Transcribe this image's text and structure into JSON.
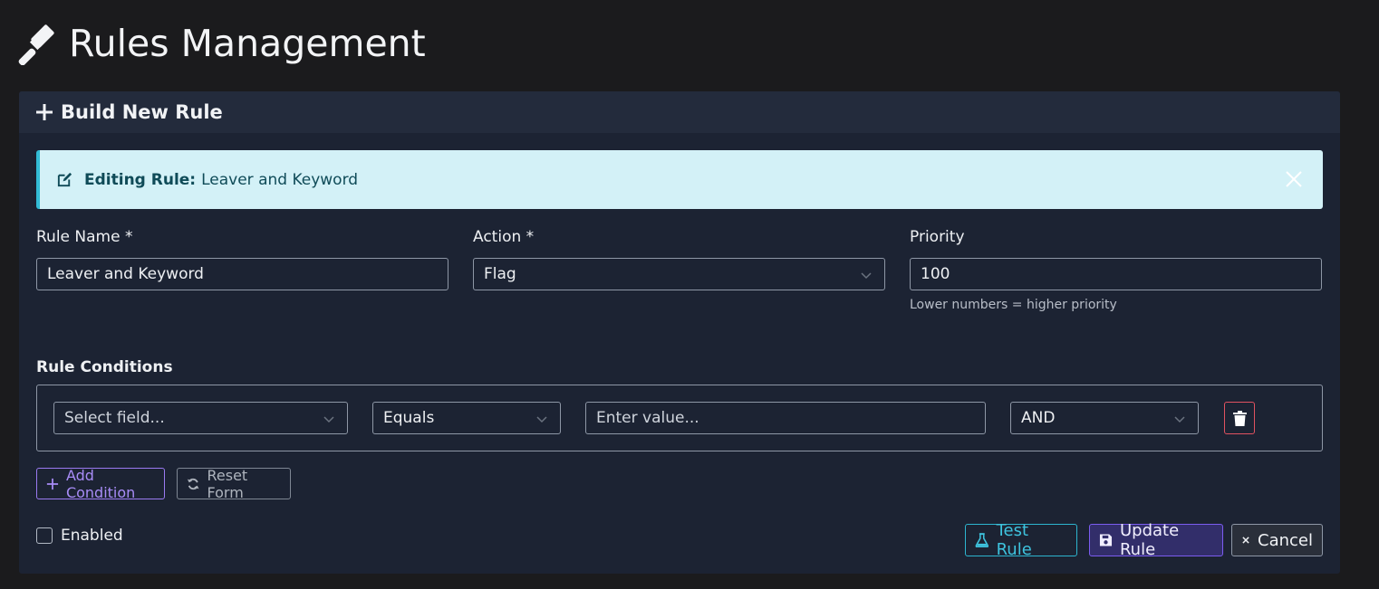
{
  "page": {
    "title": "Rules Management"
  },
  "card": {
    "header": "Build New Rule"
  },
  "alert": {
    "label": "Editing Rule:",
    "rule_name": "Leaver and Keyword"
  },
  "form": {
    "rule_name": {
      "label": "Rule Name *",
      "value": "Leaver and Keyword"
    },
    "action": {
      "label": "Action *",
      "value": "Flag"
    },
    "priority": {
      "label": "Priority",
      "value": "100",
      "help": "Lower numbers = higher priority"
    }
  },
  "conditions": {
    "label": "Rule Conditions",
    "rows": [
      {
        "field_placeholder": "Select field...",
        "operator": "Equals",
        "value_placeholder": "Enter value...",
        "logic": "AND"
      }
    ],
    "add_label": "Add Condition",
    "reset_label": "Reset Form"
  },
  "enabled": {
    "label": "Enabled",
    "checked": false
  },
  "buttons": {
    "test": "Test Rule",
    "update": "Update Rule",
    "cancel": "Cancel"
  },
  "colors": {
    "accent_info": "#32bcd6",
    "accent_primary": "#7b5cf0",
    "danger": "#e05260"
  }
}
